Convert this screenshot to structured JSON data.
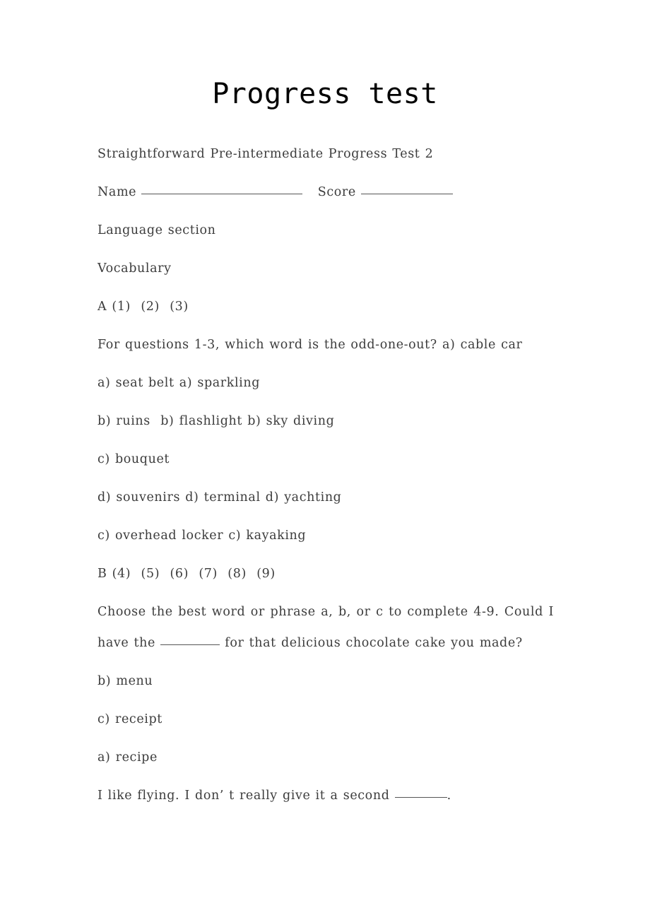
{
  "document": {
    "title": "Progress test",
    "subtitle": "Straightforward Pre-intermediate Progress Test 2",
    "name_label": "Name",
    "score_label": "Score",
    "section_heading": "Language section",
    "subsection_heading": "Vocabulary",
    "part_a_header": "A (1)  (2)  (3)",
    "part_a_instruction": "For questions 1-3, which word is the odd-one-out? a) cable car",
    "part_a_options": [
      "a) seat belt a) sparkling",
      "b) ruins  b) flashlight b) sky diving",
      "c) bouquet",
      "d) souvenirs d) terminal d) yachting",
      "c) overhead locker c) kayaking"
    ],
    "part_b_header": "B (4)  (5)  (6)  (7)  (8)  (9)",
    "part_b_instruction_start": "Choose the best word or phrase a, b, or c to complete 4-9. Could I have the ",
    "part_b_instruction_end": " for that delicious chocolate cake you made?",
    "part_b_options": [
      "b) menu",
      "c) receipt",
      "a) recipe"
    ],
    "question_5_start": "I like flying. I don’ t really give it a second ",
    "question_5_end": "."
  }
}
